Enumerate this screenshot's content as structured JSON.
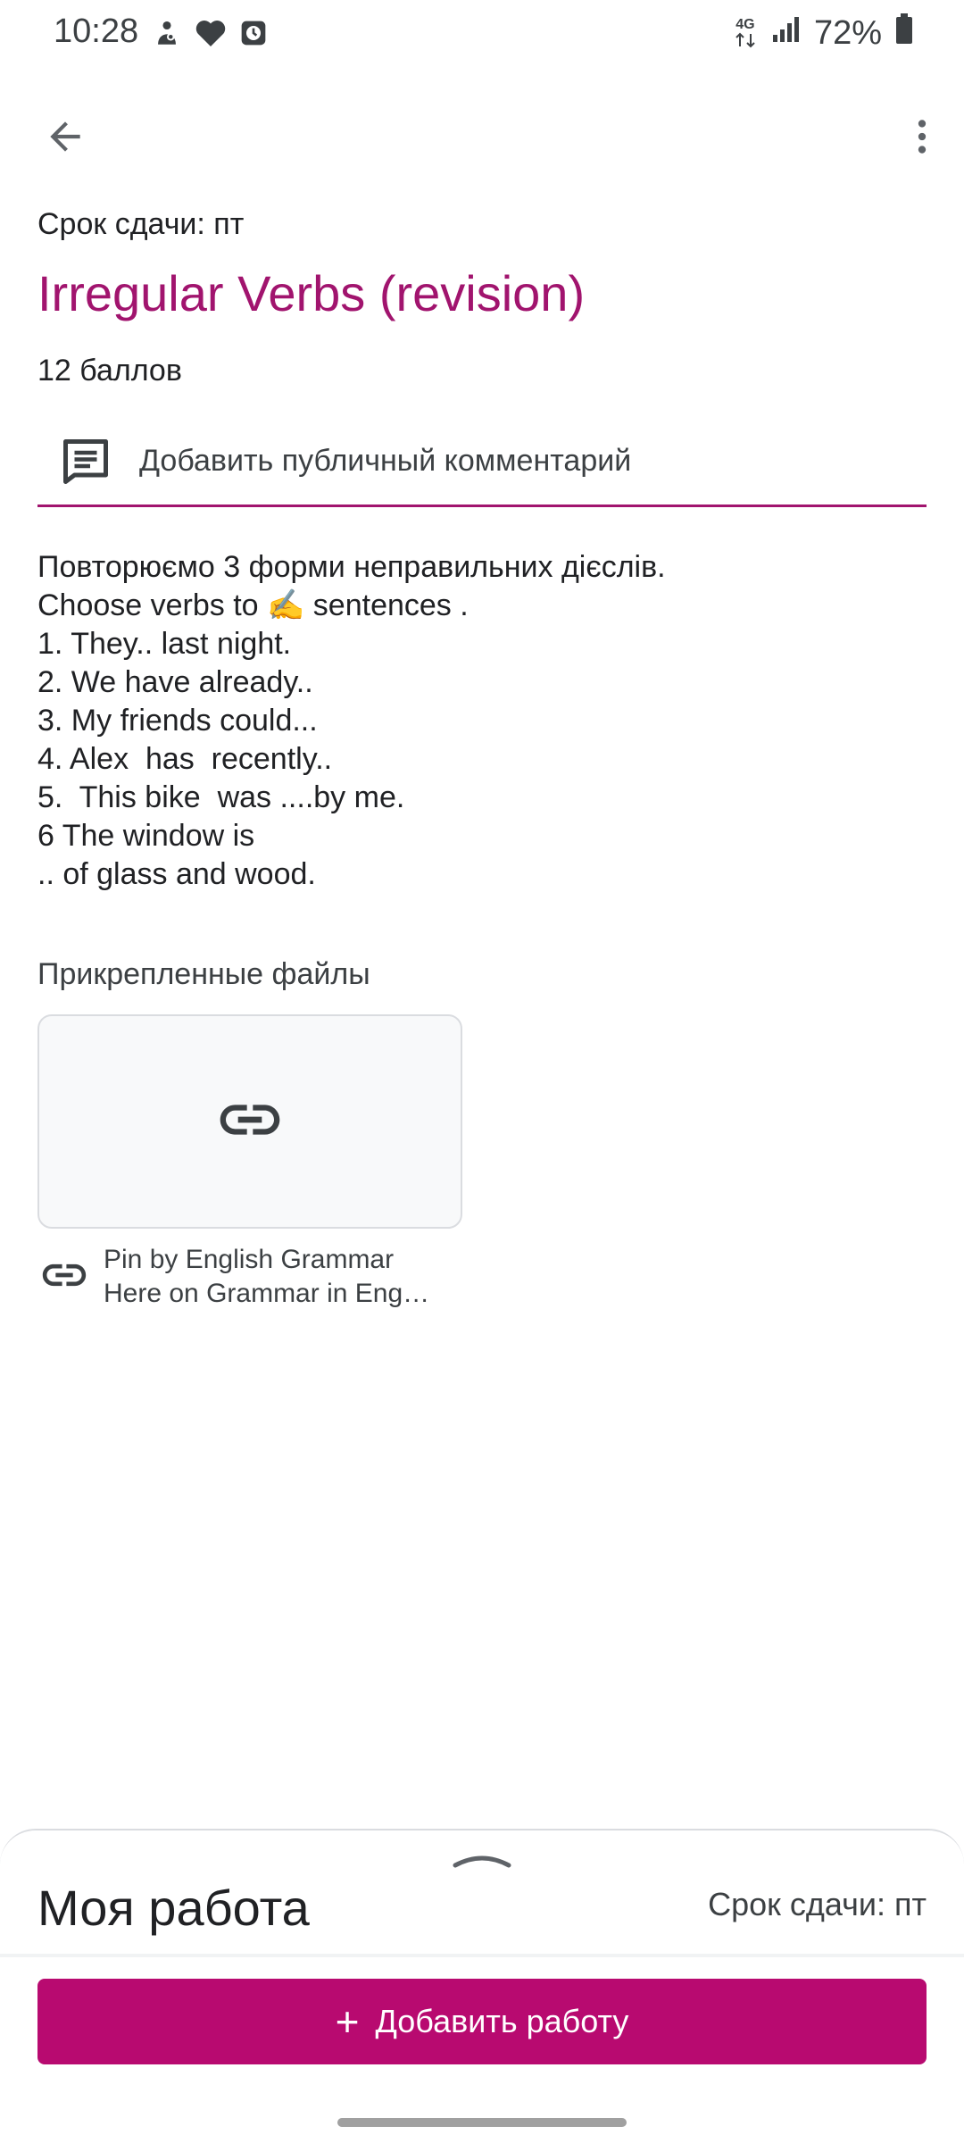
{
  "status_bar": {
    "time": "10:28",
    "network": "4G",
    "battery": "72%",
    "left_icons": [
      "person-shield-icon",
      "heart-icon",
      "alarm-icon"
    ],
    "right_icons": [
      "data-arrows-icon",
      "signal-bars-icon",
      "battery-icon"
    ]
  },
  "toolbar": {
    "back_icon": "arrow-back-icon",
    "more_icon": "more-vert-icon"
  },
  "assignment": {
    "due_label": "Срок сдачи: пт",
    "title": "Irregular Verbs (revision)",
    "points": "12 баллов",
    "comment_placeholder": "Добавить публичный комментарий",
    "description_lines": [
      "Повторюємо 3 форми неправильних дієслів.",
      "Choose verbs to ✍️ sentences .",
      "1. They.. last night.",
      "2. We have already..",
      "3. My friends could...",
      "4. Alex  has  recently..",
      "5.  This bike  was ....by me.",
      "6 The window is",
      ".. of glass and wood."
    ]
  },
  "attachments": {
    "header": "Прикрепленные файлы",
    "items": [
      {
        "title_line1": "Pin by English Grammar",
        "title_line2": "Here on Grammar in Eng…",
        "icon": "link-icon"
      }
    ]
  },
  "my_work": {
    "title": "Моя работа",
    "due_label": "Срок сдачи: пт",
    "add_button": "Добавить работу"
  },
  "colors": {
    "accent": "#a1146e",
    "button": "#b80a70"
  }
}
